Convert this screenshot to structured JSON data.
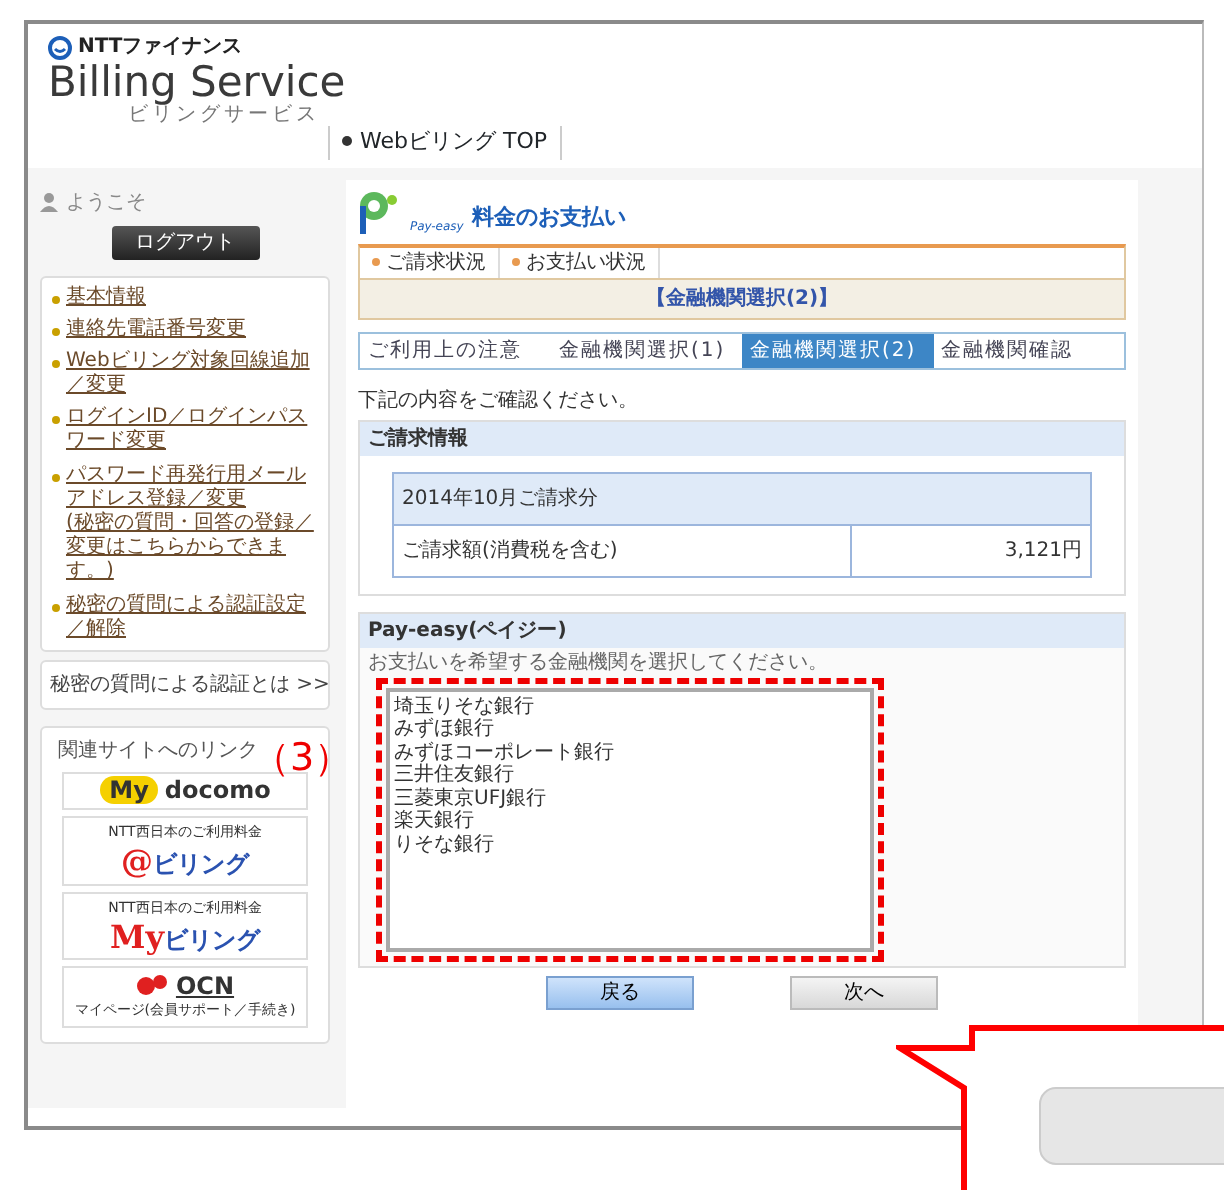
{
  "header": {
    "company": "NTTファイナンス",
    "title": "Billing Service",
    "subtitle": "ビリングサービス"
  },
  "top_nav": [
    {
      "label": "Webビリング TOP"
    }
  ],
  "sidebar": {
    "welcome": "ようこそ",
    "logout": "ログアウト",
    "links": [
      {
        "label": "基本情報"
      },
      {
        "label": "連絡先電話番号変更"
      },
      {
        "label": "Webビリング対象回線追加／変更"
      },
      {
        "label": "ログインID／ログインパスワード変更"
      },
      {
        "label": "パスワード再発行用メールアドレス登録／変更",
        "note": "(秘密の質問・回答の登録／変更はこちらからできます。)"
      },
      {
        "label": "秘密の質問による認証設定／解除"
      }
    ],
    "auth_link": "秘密の質問による認証とは >>",
    "related": {
      "title": "関連サイトへのリンク",
      "sites": [
        {
          "kind": "docomo",
          "mark": "My",
          "name": "docomo"
        },
        {
          "kind": "billing",
          "caption": "NTT西日本のご利用料金",
          "mark": "@",
          "name": "ビリング"
        },
        {
          "kind": "mybilling",
          "caption": "NTT西日本のご利用料金",
          "mark": "My",
          "name": "ビリング"
        },
        {
          "kind": "ocn",
          "name": "OCN",
          "caption": "マイページ(会員サポート／手続き)"
        }
      ]
    }
  },
  "main": {
    "logo": "Pay-easy",
    "heading": "料金のお支払い",
    "tabs": [
      {
        "label": "ご請求状況"
      },
      {
        "label": "お支払い状況"
      }
    ],
    "page_title": "【金融機関選択(2)】",
    "steps": [
      {
        "label": "ご利用上の注意",
        "selected": false
      },
      {
        "label": "金融機関選択(1)",
        "selected": false
      },
      {
        "label": "金融機関選択(2)",
        "selected": true
      },
      {
        "label": "金融機関確認",
        "selected": false
      }
    ],
    "intro": "下記の内容をご確認ください。",
    "billing": {
      "title": "ご請求情報",
      "period": "2014年10月ご請求分",
      "amount_label": "ご請求額(消費税を含む)",
      "amount": "3,121円"
    },
    "payeasy": {
      "title": "Pay-easy(ペイジー)",
      "instruction": "お支払いを希望する金融機関を選択してください。",
      "banks": [
        {
          "label": "埼玉りそな銀行",
          "selected": false
        },
        {
          "label": "みずほ銀行",
          "selected": false
        },
        {
          "label": "みずほコーポレート銀行",
          "selected": false
        },
        {
          "label": "三井住友銀行",
          "selected": false
        },
        {
          "label": "三菱東京UFJ銀行",
          "selected": false
        },
        {
          "label": "楽天銀行",
          "selected": false
        },
        {
          "label": "りそな銀行",
          "selected": false
        }
      ]
    },
    "buttons": [
      {
        "label": "戻る",
        "kind": "primary"
      },
      {
        "label": "次へ",
        "kind": "secondary"
      }
    ]
  },
  "annotation": {
    "label": "（3）"
  }
}
